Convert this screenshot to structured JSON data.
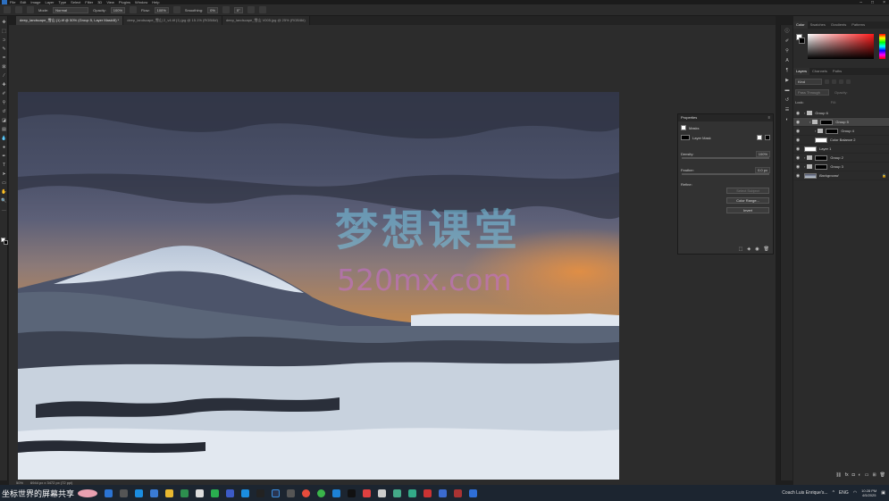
{
  "menu": [
    "File",
    "Edit",
    "Image",
    "Layer",
    "Type",
    "Select",
    "Filter",
    "3D",
    "View",
    "Plugins",
    "Window",
    "Help"
  ],
  "options": {
    "mode_label": "Mode:",
    "mode_value": "Normal",
    "opacity_label": "Opacity:",
    "opacity_value": "100%",
    "flow_label": "Flow:",
    "flow_value": "100%",
    "smoothing_label": "Smoothing:",
    "smoothing_value": "0%",
    "angle_value": "0°"
  },
  "tabs": [
    {
      "label": "deep_landscape_雪山 (1).tif @ 50% (Group 5, Layer Mask/8) *"
    },
    {
      "label": "deep_landscape_雪山 2_v4.tif (1).jpg @ 15.1% (RGB/8#)"
    },
    {
      "label": "deep_landscape_雪山 V005.jpg @ 25% (RGB/8#)"
    }
  ],
  "status": {
    "zoom": "50%",
    "doc": "6944 px x 3472 px (72 ppi)"
  },
  "watermark": {
    "line1": "梦想课堂",
    "line2": "520mx.com"
  },
  "properties": {
    "title": "Properties",
    "section": "Masks",
    "mask_type": "Layer Mask",
    "density_label": "Density:",
    "density_value": "100%",
    "feather_label": "Feather:",
    "feather_value": "0.0 px",
    "refine_label": "Refine:",
    "select_subject": "Select Subject",
    "color_range": "Color Range...",
    "invert": "Invert"
  },
  "color_tabs": [
    "Color",
    "Swatches",
    "Gradients",
    "Patterns"
  ],
  "layer_tabs": [
    "Layers",
    "Channels",
    "Paths"
  ],
  "layer_controls": {
    "kind": "Kind",
    "blend": "Pass Through",
    "opacity_label": "Opacity:",
    "lock_label": "Lock:",
    "fill_label": "Fill:"
  },
  "layers": [
    {
      "name": "Group 6",
      "indent": 0,
      "kind": "folder",
      "selected": false
    },
    {
      "name": "Group 5",
      "indent": 1,
      "kind": "folder-mask",
      "selected": true
    },
    {
      "name": "Group 4",
      "indent": 2,
      "kind": "folder-mask",
      "selected": false
    },
    {
      "name": "Color Balance 2",
      "indent": 2,
      "kind": "adjust",
      "selected": false
    },
    {
      "name": "Layer 1",
      "indent": 0,
      "kind": "layer-white",
      "selected": false
    },
    {
      "name": "Group 2",
      "indent": 0,
      "kind": "folder-mask",
      "selected": false
    },
    {
      "name": "Group 3",
      "indent": 0,
      "kind": "folder-mask",
      "selected": false
    },
    {
      "name": "Background",
      "indent": 0,
      "kind": "background",
      "selected": false
    }
  ],
  "taskbar": {
    "overlay_text": "坐标世界的屏幕共享",
    "notification": "Coach Luis Enrique's...",
    "lang": "ENG",
    "time": "10:28 PM",
    "date": "4/5/2025"
  }
}
